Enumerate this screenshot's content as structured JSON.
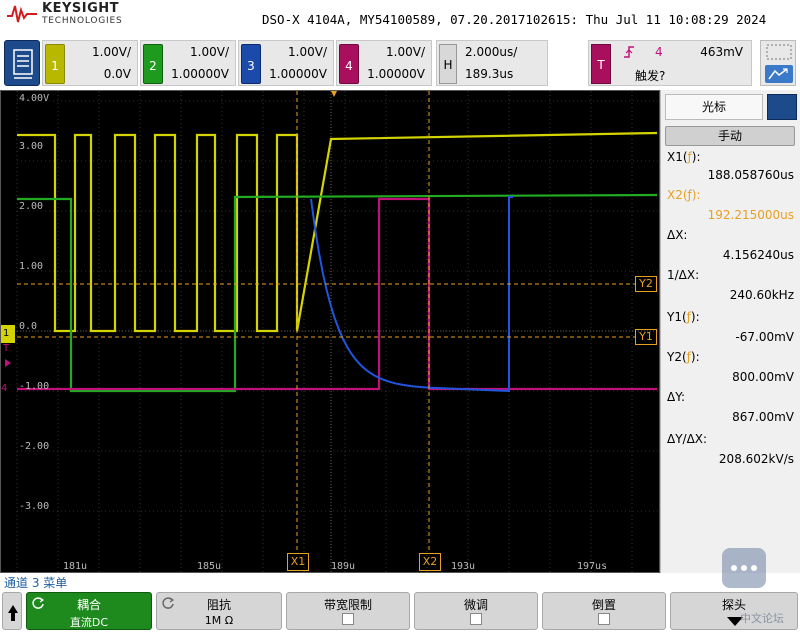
{
  "colors": {
    "ch1": "#d4d400",
    "ch2": "#22aa22",
    "ch3": "#2255dd",
    "ch4": "#c0107a",
    "cursor": "#e8a020",
    "grid": "#555555",
    "accent_blue": "#1c4a8a",
    "softkey_active": "#1e8a1e"
  },
  "header": {
    "brand": "KEYSIGHT",
    "brand_sub": "TECHNOLOGIES",
    "title": "DSO-X 4104A, MY54100589, 07.20.2017102615: Thu Jul 11 10:08:29 2024"
  },
  "controls": {
    "channels": [
      {
        "num": "1",
        "scale": "1.00V/",
        "offset": "0.0V"
      },
      {
        "num": "2",
        "scale": "1.00V/",
        "offset": "1.00000V"
      },
      {
        "num": "3",
        "scale": "1.00V/",
        "offset": "1.00000V"
      },
      {
        "num": "4",
        "scale": "1.00V/",
        "offset": "1.00000V"
      }
    ],
    "horizontal": {
      "label": "H",
      "scale": "2.000us/",
      "delay": "189.3us"
    },
    "trigger": {
      "label": "T",
      "source": "4",
      "level": "463mV",
      "status": "触发?"
    }
  },
  "screen": {
    "y_labels": [
      "4.00V",
      "3.00",
      "2.00",
      "1.00",
      "0.0",
      "-1.00",
      "-2.00",
      "-3.00"
    ],
    "x_labels": [
      "181u",
      "185u",
      "189u",
      "193u",
      "197us"
    ],
    "cursor_tags": {
      "x1": "X1",
      "x2": "X2",
      "y1": "Y1",
      "y2": "Y2"
    },
    "markers": {
      "ch1": "1",
      "trig": "T",
      "ch4": "4"
    }
  },
  "cursor_panel": {
    "title": "光标",
    "mode": "手动",
    "x1_label": "X1(",
    "x1_sym": "ƒ",
    "x1_close": "):",
    "x1_value": "188.058760us",
    "x2_label": "X2(",
    "x2_sym": "ƒ",
    "x2_close": "):",
    "x2_value": "192.215000us",
    "dx_label": "ΔX:",
    "dx_value": "4.156240us",
    "inv_dx_label": "1/ΔX:",
    "inv_dx_value": "240.60kHz",
    "y1_label": "Y1(",
    "y1_sym": "ƒ",
    "y1_close": "):",
    "y1_value": "-67.00mV",
    "y2_label": "Y2(",
    "y2_sym": "ƒ",
    "y2_close": "):",
    "y2_value": "800.00mV",
    "dy_label": "ΔY:",
    "dy_value": "867.00mV",
    "dydx_label": "ΔY/ΔX:",
    "dydx_value": "208.602kV/s"
  },
  "menu_label": "通道 3 菜单",
  "softkeys": [
    {
      "top": "耦合",
      "bottom": "直流DC"
    },
    {
      "top": "阻抗",
      "bottom": "1M Ω"
    },
    {
      "top": "带宽限制",
      "bottom": ""
    },
    {
      "top": "微调",
      "bottom": ""
    },
    {
      "top": "倒置",
      "bottom": ""
    },
    {
      "top": "探头",
      "bottom": ""
    }
  ],
  "watermark": "中文论坛"
}
